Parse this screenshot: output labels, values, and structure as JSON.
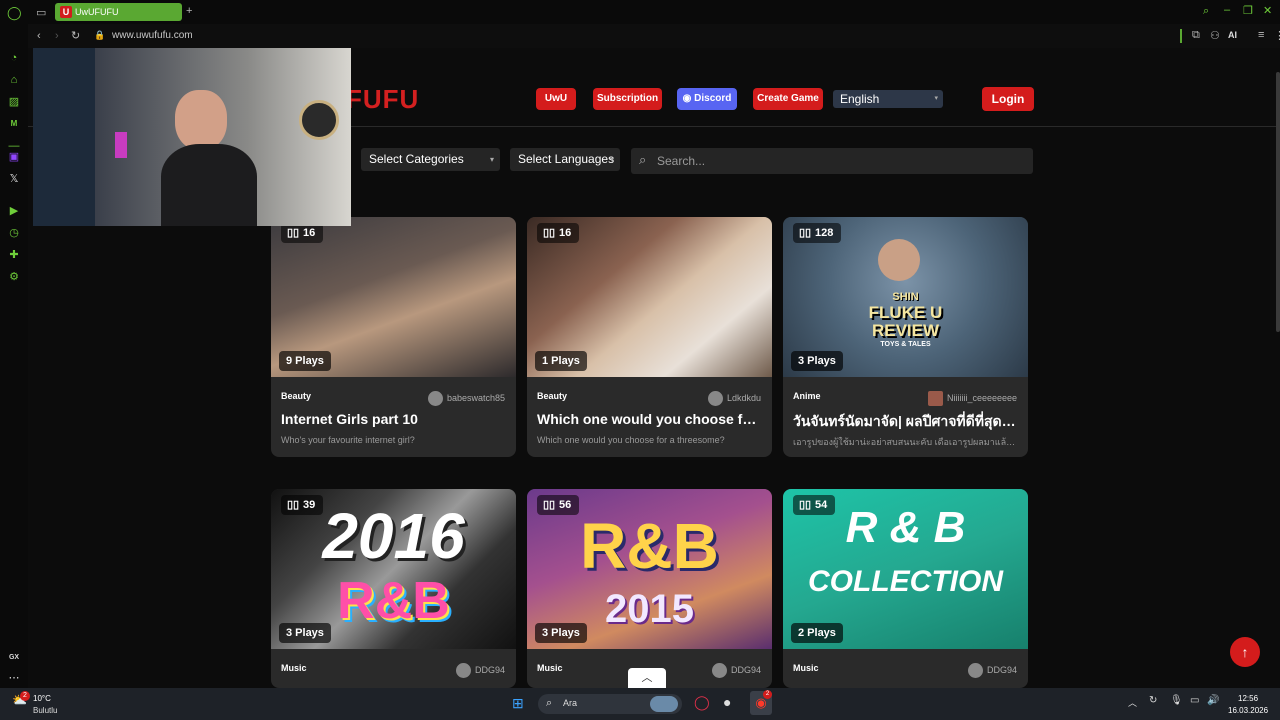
{
  "browser": {
    "tab_title": "UwUFUFU",
    "tab_favicon": "U",
    "url": "www.uwufufu.com",
    "ai_label": "AI",
    "accent_color": "#5aa832"
  },
  "site": {
    "logo_text": "FUFU",
    "nav": {
      "uwu": "UwU",
      "subscription": "Subscription",
      "discord": "Discord",
      "create_game": "Create Game"
    },
    "language": "English",
    "login": "Login",
    "brand_color": "#d41c1c"
  },
  "filters": {
    "categories": "Select Categories",
    "languages": "Select Languages",
    "search_placeholder": "Search..."
  },
  "cards": [
    {
      "count": "16",
      "plays": "9 Plays",
      "category": "Beauty",
      "author": "babeswatch85",
      "title": "Internet Girls part 10",
      "desc": "Who's your favourite internet girl?"
    },
    {
      "count": "16",
      "plays": "1 Plays",
      "category": "Beauty",
      "author": "Ldkdkdu",
      "title": "Which one would you choose for…",
      "desc": "Which one would you choose for a threesome?"
    },
    {
      "count": "128",
      "plays": "3 Plays",
      "category": "Anime",
      "author": "Niiiiiii_ceeeeeeee",
      "title": "วันจันทร์นัดมาจัด| ผลปีศาจที่ดีที่สุด…",
      "desc": "เอารูปของผู้ใช้มาน่ะอย่าสบสนนะคับ เดือเอารูปผลมาแล้ว…"
    },
    {
      "count": "39",
      "plays": "3 Plays",
      "category": "Music",
      "author": "DDG94",
      "title": "",
      "desc": ""
    },
    {
      "count": "56",
      "plays": "3 Plays",
      "category": "Music",
      "author": "DDG94",
      "title": "",
      "desc": ""
    },
    {
      "count": "54",
      "plays": "2 Plays",
      "category": "Music",
      "author": "DDG94",
      "title": "",
      "desc": ""
    }
  ],
  "card_art_text": {
    "shin": "SHIN",
    "fluke": "FLUKE U",
    "review": "REVIEW",
    "toys": "TOYS & TALES",
    "y2016": "2016",
    "rb1": "R&B",
    "rb2": "R&B",
    "y2015": "2015",
    "rb3": "R & B",
    "collection": "COLLECTION"
  },
  "taskbar": {
    "weather_temp": "10°C",
    "weather_desc": "Bulutlu",
    "search_placeholder": "Ara",
    "time": "12:56",
    "date": "16.03.2026",
    "notif_count": "2",
    "opera_badge": "2"
  }
}
